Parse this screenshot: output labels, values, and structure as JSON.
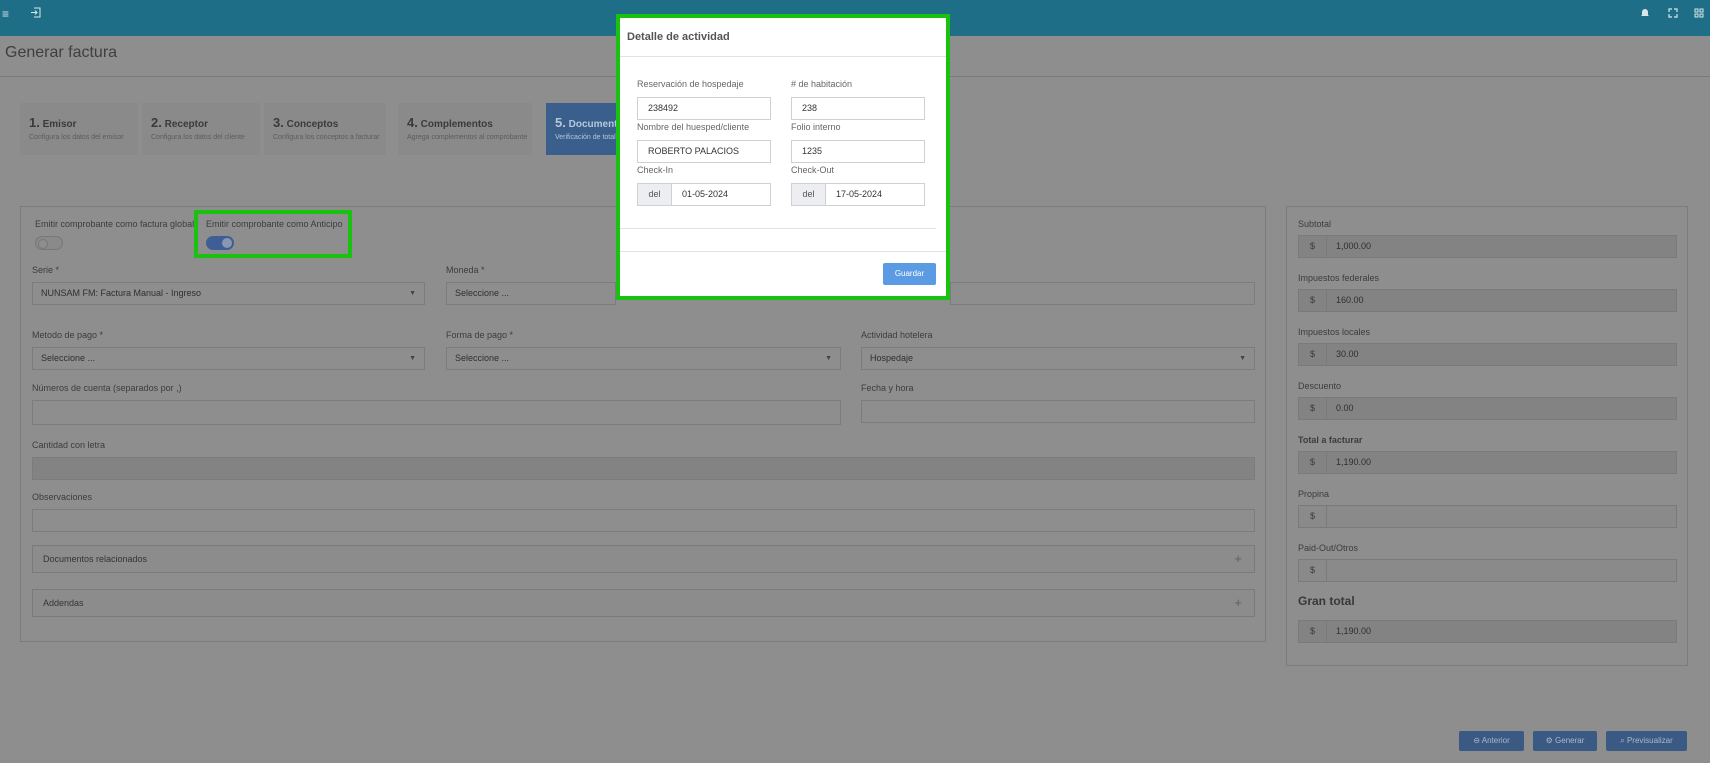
{
  "topbar": {
    "icons": [
      "menu-icon",
      "exit-icon",
      "bell-icon",
      "fullscreen-icon",
      "apps-icon"
    ]
  },
  "page": {
    "title": "Generar factura"
  },
  "steps": [
    {
      "num": "1.",
      "title": "Emisor",
      "subtitle": "Configura los datos del emisor"
    },
    {
      "num": "2.",
      "title": "Receptor",
      "subtitle": "Configura los datos del cliente"
    },
    {
      "num": "3.",
      "title": "Conceptos",
      "subtitle": "Configura los conceptos a facturar"
    },
    {
      "num": "4.",
      "title": "Complementos",
      "subtitle": "Agrega complementos al comprobante"
    },
    {
      "num": "5.",
      "title": "Documento",
      "subtitle": "Verificación de total"
    }
  ],
  "form": {
    "global_label": "Emitir comprobante como factura global",
    "global_on": false,
    "anticipo_label": "Emitir comprobante como Anticipo",
    "anticipo_on": true,
    "serie_label": "Serie *",
    "serie_value": "NUNSAM FM: Factura Manual - Ingreso",
    "moneda_label": "Moneda *",
    "moneda_value": "Seleccione ...",
    "metodo_label": "Metodo de pago *",
    "metodo_value": "Seleccione ...",
    "forma_label": "Forma de pago *",
    "forma_value": "Seleccione ...",
    "actividad_label": "Actividad hotelera",
    "actividad_value": "Hospedaje",
    "cuentas_label": "Números de cuenta (separados por ,)",
    "fecha_label": "Fecha y hora",
    "cantidad_label": "Cantidad con letra",
    "observaciones_label": "Observaciones",
    "docs_label": "Documentos relacionados",
    "addendas_label": "Addendas",
    "plus": "+"
  },
  "summary": {
    "currency": "$",
    "subtotal_label": "Subtotal",
    "subtotal": "1,000.00",
    "federales_label": "Impuestos federales",
    "federales": "160.00",
    "locales_label": "Impuestos locales",
    "locales": "30.00",
    "descuento_label": "Descuento",
    "descuento": "0.00",
    "total_label": "Total a facturar",
    "total": "1,190.00",
    "propina_label": "Propina",
    "paidout_label": "Paid-Out/Otros",
    "gran_total_label": "Gran total",
    "gran_total": "1,190.00"
  },
  "buttons": {
    "anterior": "Anterior",
    "generar": "Generar",
    "previsualizar": "Previsualizar"
  },
  "modal": {
    "title": "Detalle de actividad",
    "reservacion_label": "Reservación de hospedaje",
    "reservacion": "238492",
    "habitacion_label": "# de habitación",
    "habitacion": "238",
    "huesped_label": "Nombre del huesped/cliente",
    "huesped": "ROBERTO PALACIOS",
    "folio_label": "Folio interno",
    "folio": "1235",
    "checkin_label": "Check-In",
    "checkin": "01-05-2024",
    "checkout_label": "Check-Out",
    "checkout": "17-05-2024",
    "del": "del",
    "save": "Guardar"
  },
  "colors": {
    "highlight": "#19c20f",
    "topbar": "#1e6e87",
    "primary": "#5a9be3"
  }
}
